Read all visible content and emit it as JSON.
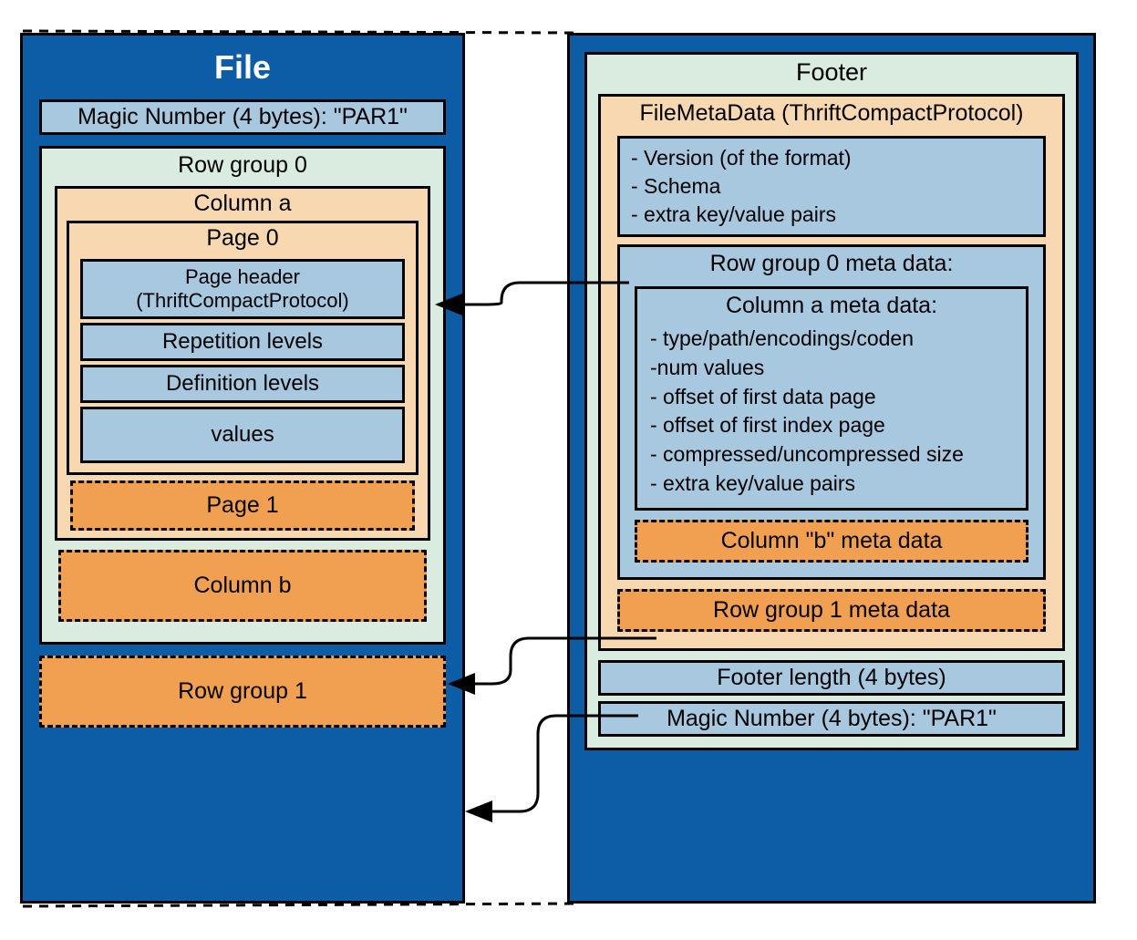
{
  "file": {
    "title": "File",
    "magic_top": "Magic Number (4 bytes): \"PAR1\"",
    "rowgroup0": {
      "title": "Row group 0",
      "column_a": {
        "title": "Column a",
        "page0": {
          "title": "Page 0",
          "page_header": "Page header (ThriftCompactProtocol)",
          "repetition": "Repetition levels",
          "definition": "Definition levels",
          "values": "values"
        },
        "page1": "Page 1"
      },
      "column_b": "Column b"
    },
    "rowgroup1": "Row group 1"
  },
  "footer": {
    "title": "Footer",
    "filemeta": {
      "title": "FileMetaData (ThriftCompactProtocol)",
      "top_items": [
        "- Version (of the format)",
        "- Schema",
        "- extra key/value pairs"
      ],
      "rowgroup0_meta": {
        "title": "Row group 0 meta data:",
        "column_a_meta": {
          "title": "Column a meta data:",
          "items": [
            "- type/path/encodings/coden",
            "-num values",
            "- offset of first data page",
            "- offset of first index page",
            "- compressed/uncompressed size",
            "- extra key/value pairs"
          ]
        },
        "column_b_meta": "Column \"b\" meta data"
      },
      "rowgroup1_meta": "Row group 1 meta data"
    },
    "footer_length": "Footer length (4 bytes)",
    "magic_bottom": "Magic Number (4 bytes): \"PAR1\""
  }
}
